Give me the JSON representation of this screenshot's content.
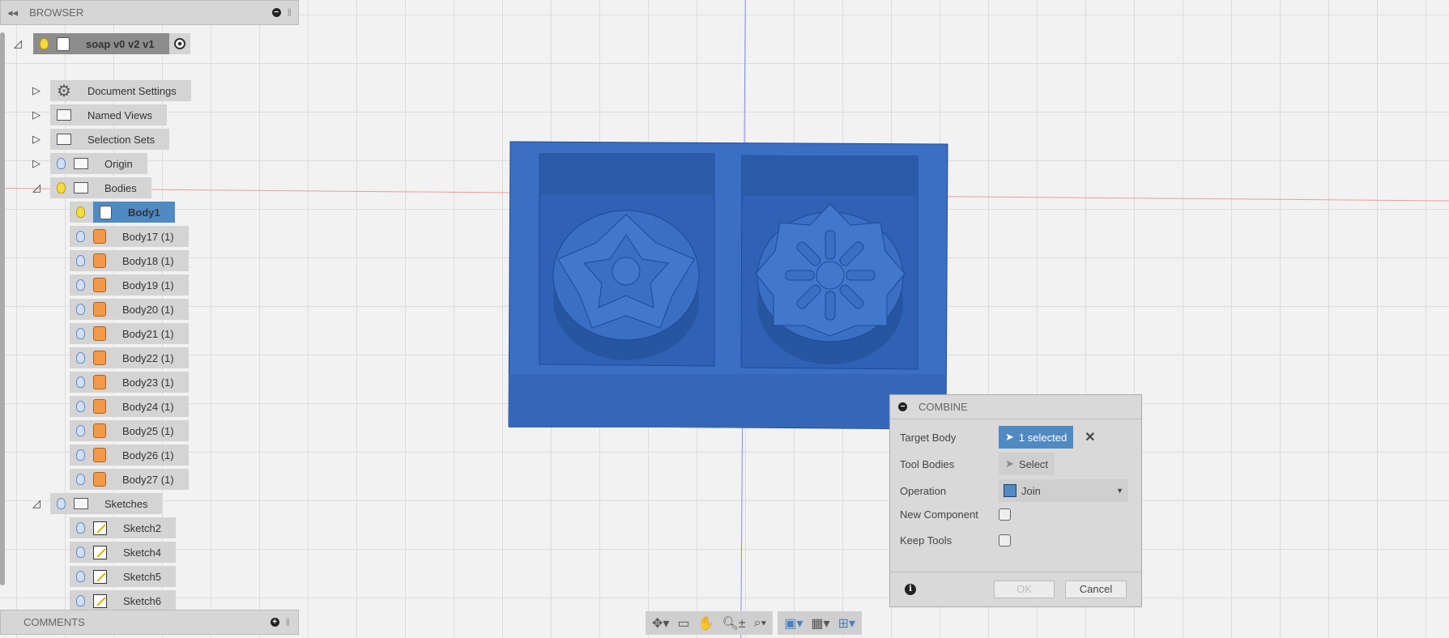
{
  "browser": {
    "title": "BROWSER",
    "root": "soap v0 v2 v1",
    "items": [
      {
        "label": "Document Settings",
        "icon": "gear-icon"
      },
      {
        "label": "Named Views",
        "icon": "folder-icon"
      },
      {
        "label": "Selection Sets",
        "icon": "folder-icon"
      },
      {
        "label": "Origin",
        "icon": "folder-icon"
      },
      {
        "label": "Bodies",
        "icon": "folder-icon"
      }
    ],
    "bodies": [
      "Body1",
      "Body17 (1)",
      "Body18 (1)",
      "Body19 (1)",
      "Body20 (1)",
      "Body21 (1)",
      "Body22 (1)",
      "Body23 (1)",
      "Body24 (1)",
      "Body25 (1)",
      "Body26 (1)",
      "Body27 (1)"
    ],
    "sketches_label": "Sketches",
    "sketches": [
      "Sketch2",
      "Sketch4",
      "Sketch5",
      "Sketch6"
    ]
  },
  "comments": {
    "title": "COMMENTS"
  },
  "dialog": {
    "title": "COMBINE",
    "target_body_label": "Target Body",
    "target_body_value": "1 selected",
    "tool_bodies_label": "Tool Bodies",
    "tool_bodies_value": "Select",
    "operation_label": "Operation",
    "operation_value": "Join",
    "new_component_label": "New Component",
    "new_component_checked": false,
    "keep_tools_label": "Keep Tools",
    "keep_tools_checked": false,
    "ok": "OK",
    "cancel": "Cancel"
  },
  "colors": {
    "model": "#3a6fc4",
    "selection": "#4f8ac3"
  }
}
